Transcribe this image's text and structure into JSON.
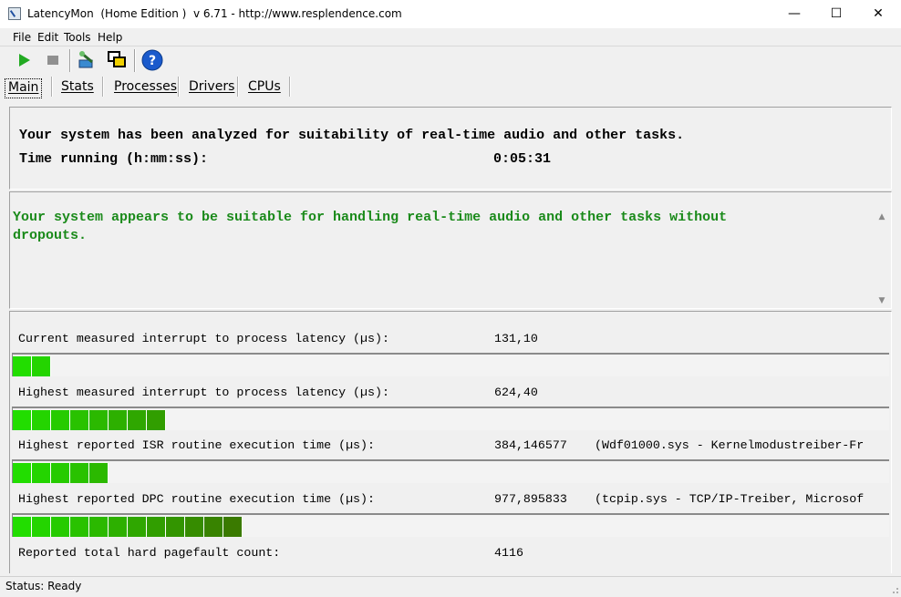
{
  "window": {
    "title": "LatencyMon  (Home Edition )  v 6.71 - http://www.resplendence.com",
    "minimize_glyph": "—",
    "maximize_glyph": "☐",
    "close_glyph": "✕"
  },
  "menu": [
    "File",
    "Edit",
    "Tools",
    "Help"
  ],
  "toolbar": {
    "start_icon": "play-icon",
    "stop_icon": "stop-icon",
    "inspect_icon": "tool-icon",
    "windows_icon": "windows-icon",
    "help_icon": "help-icon",
    "help_glyph": "?"
  },
  "tabs": [
    "Main",
    "Stats",
    "Processes",
    "Drivers",
    "CPUs"
  ],
  "summary": {
    "line1": "Your system has been analyzed for suitability of real-time audio and other tasks.",
    "time_label": "Time running (h:mm:ss):",
    "time_value": "0:05:31"
  },
  "conclusion": {
    "line1": "Your system appears to be suitable for handling real-time audio and other tasks without",
    "line2": "dropouts."
  },
  "metrics": [
    {
      "label": "Current measured interrupt to process latency (µs):",
      "value": "131,10",
      "extra": "",
      "bar_segments": 2
    },
    {
      "label": "Highest measured interrupt to process latency (µs):",
      "value": "624,40",
      "extra": "",
      "bar_segments": 8
    },
    {
      "label": "Highest reported ISR routine execution time (µs):",
      "value": "384,146577",
      "extra": "(Wdf01000.sys - Kernelmodustreiber-Fr",
      "bar_segments": 5
    },
    {
      "label": "Highest reported DPC routine execution time (µs):",
      "value": "977,895833",
      "extra": "(tcpip.sys - TCP/IP-Treiber, Microsof",
      "bar_segments": 12
    },
    {
      "label": "Reported total hard pagefault count:",
      "value": "4116",
      "extra": ""
    }
  ],
  "colors": {
    "bar_bright": "#22dd00",
    "bar_dark": "#3a7a00",
    "conclusion_text": "#1a8a1a"
  },
  "status": "Status: Ready"
}
